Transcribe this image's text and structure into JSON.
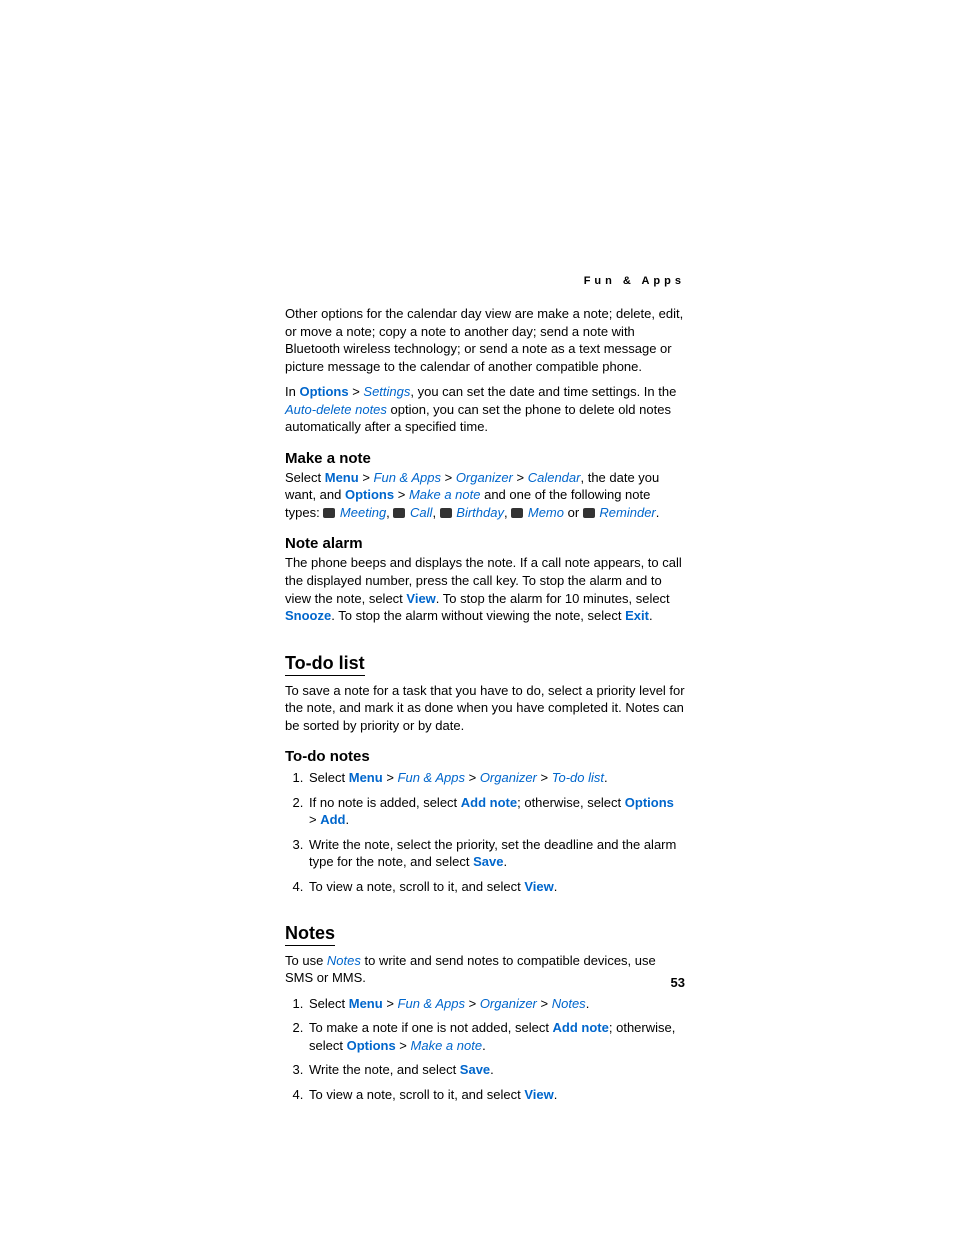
{
  "header": "Fun & Apps",
  "intro_p1": "Other options for the calendar day view are make a note; delete, edit, or move a note; copy a note to another day; send a note with Bluetooth wireless technology; or send a note as a text message or picture message to the calendar of another compatible phone.",
  "p2_pre": "In ",
  "p2_options": "Options",
  "p2_gt1": " > ",
  "p2_settings": "Settings",
  "p2_mid": ", you can set the date and time settings. In the ",
  "p2_autodel": "Auto-delete notes",
  "p2_post": " option, you can set the phone to delete old notes automatically after a specified time.",
  "make_note_h": "Make a note",
  "mn_select": "Select ",
  "mn_menu": "Menu",
  "mn_gt": " > ",
  "mn_fun": "Fun & Apps",
  "mn_org": "Organizer",
  "mn_cal": "Calendar",
  "mn_after_cal": ", the date you want, and ",
  "mn_options": "Options",
  "mn_make": "Make a note",
  "mn_types": " and one of the following note types: ",
  "mn_meeting": "Meeting",
  "mn_call": "Call",
  "mn_birthday": "Birthday",
  "mn_memo": "Memo",
  "mn_or": " or ",
  "mn_reminder": "Reminder",
  "note_alarm_h": "Note alarm",
  "na_p_pre": "The phone beeps and displays the note. If a call note appears, to call the displayed number, press the call key. To stop the alarm and to view the note, select ",
  "na_view": "View",
  "na_mid1": ". To stop the alarm for 10 minutes, select ",
  "na_snooze": "Snooze",
  "na_mid2": ". To stop the alarm without viewing the note, select ",
  "na_exit": "Exit",
  "todo_h": "To-do list",
  "todo_p": "To save a note for a task that you have to do, select a priority level for the note, and mark it as done when you have completed it. Notes can be sorted by priority or by date.",
  "todo_notes_h": "To-do notes",
  "td1_select": "Select ",
  "td1_menu": "Menu",
  "td1_fun": "Fun & Apps",
  "td1_org": "Organizer",
  "td1_todo": "To-do list",
  "td2_pre": "If no note is added, select ",
  "td2_add": "Add note",
  "td2_mid": "; otherwise, select ",
  "td2_options": "Options",
  "td2_gt": " > ",
  "td2_addb": "Add",
  "td3_pre": "Write the note, select the priority, set the deadline and the alarm type for the note, and select ",
  "td3_save": "Save",
  "td4_pre": "To view a note, scroll to it, and select ",
  "td4_view": "View",
  "notes_h": "Notes",
  "notes_p_pre": "To use ",
  "notes_p_link": "Notes",
  "notes_p_post": " to write and send notes to compatible devices, use SMS or MMS.",
  "n1_select": "Select ",
  "n1_menu": "Menu",
  "n1_fun": "Fun & Apps",
  "n1_org": "Organizer",
  "n1_notes": "Notes",
  "n2_pre": "To make a note if one is not added, select ",
  "n2_add": "Add note",
  "n2_mid": "; otherwise, select ",
  "n2_options": "Options",
  "n2_gt": " > ",
  "n2_make": "Make a note",
  "n3_pre": "Write the note, and select ",
  "n3_save": "Save",
  "n4_pre": "To view a note, scroll to it, and select ",
  "n4_view": "View",
  "page_num": "53",
  "comma": ", ",
  "period": "."
}
